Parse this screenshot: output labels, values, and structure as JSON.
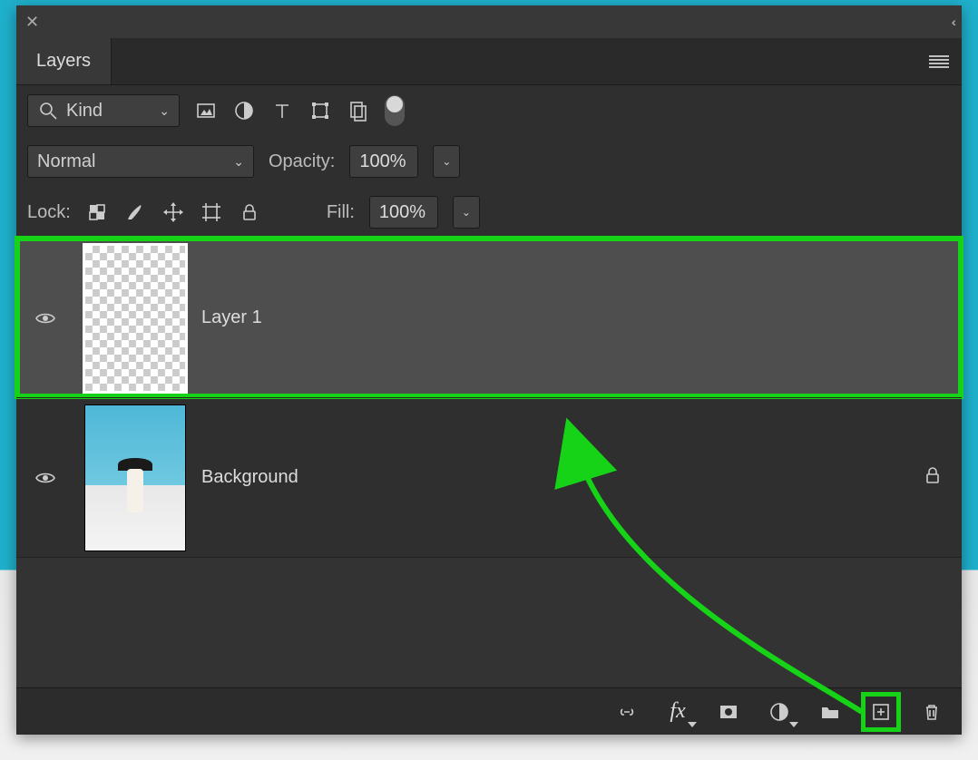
{
  "panel": {
    "tab_label": "Layers"
  },
  "filter": {
    "kind_label": "Kind"
  },
  "blend": {
    "mode": "Normal",
    "opacity_label": "Opacity:",
    "opacity_value": "100%"
  },
  "lock": {
    "label": "Lock:",
    "fill_label": "Fill:",
    "fill_value": "100%"
  },
  "layers": [
    {
      "name": "Layer 1",
      "selected": true,
      "transparent": true,
      "locked": false
    },
    {
      "name": "Background",
      "selected": false,
      "transparent": false,
      "locked": true
    }
  ],
  "annotation": {
    "arrow_color": "#17d317"
  }
}
